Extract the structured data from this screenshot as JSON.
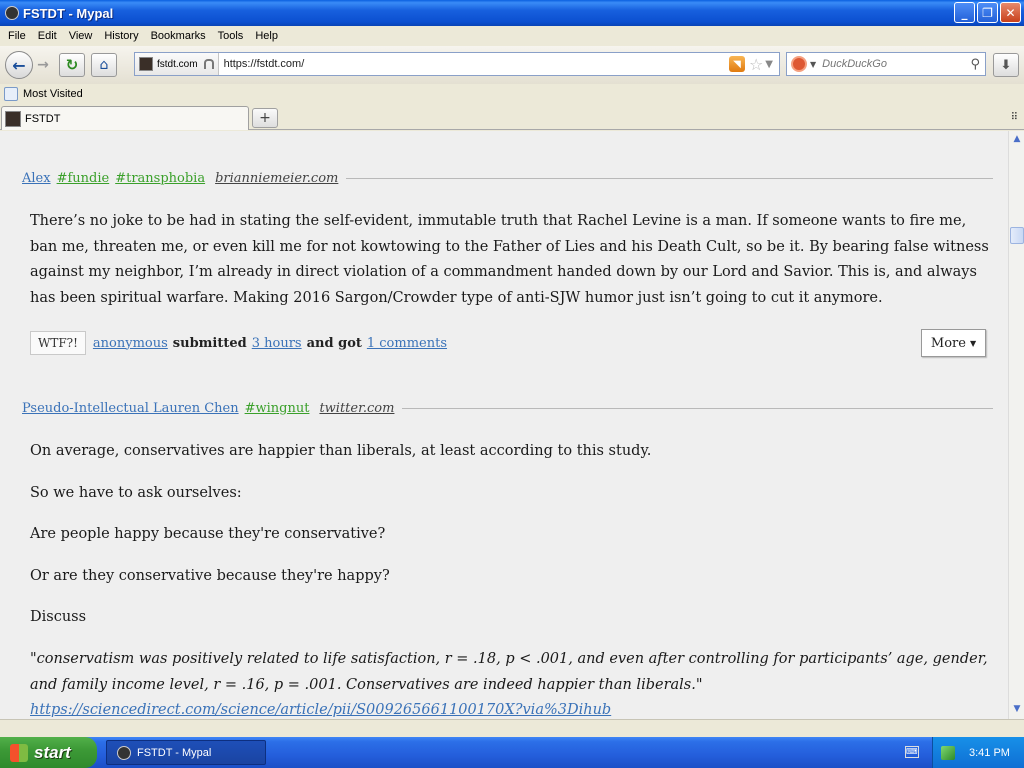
{
  "window": {
    "title": "FSTDT - Mypal",
    "minimize": "_",
    "maximize": "❐",
    "close": "✕"
  },
  "menu": [
    "File",
    "Edit",
    "View",
    "History",
    "Bookmarks",
    "Tools",
    "Help"
  ],
  "nav": {
    "identity": "fstdt.com",
    "url": "https://fstdt.com/",
    "search_placeholder": "DuckDuckGo"
  },
  "bookmarks": {
    "most_visited": "Most Visited"
  },
  "tab": {
    "title": "FSTDT"
  },
  "posts": [
    {
      "author": "Alex",
      "tags": [
        "#fundie",
        "#transphobia"
      ],
      "source": "brianniemeier.com",
      "paragraphs": [
        "There’s no joke to be had in stating the self-evident, immutable truth that Rachel Levine is a man. If someone wants to fire me, ban me, threaten me, or even kill me for not kowtowing to the Father of Lies and his Death Cult, so be it. By bearing false witness against my neighbor, I’m already in direct violation of a commandment handed down by our Lord and Savior. This is, and always has been spiritual warfare. Making 2016 Sargon/Crowder type of anti-SJW humor just isn’t going to cut it anymore."
      ],
      "actions": {
        "wtf": "WTF?!",
        "submitter": "anonymous",
        "submitted_word": "submitted",
        "time": "3 hours",
        "got_word": "and got",
        "comments": "1 comments",
        "more": "More"
      }
    },
    {
      "author": "Pseudo-Intellectual Lauren Chen",
      "tags": [
        "#wingnut"
      ],
      "source": "twitter.com",
      "paragraphs": [
        "On average, conservatives are happier than liberals, at least according to this study.",
        "So we have to ask ourselves:",
        "Are people happy because they're conservative?",
        "Or are they conservative because they're happy?",
        "Discuss"
      ],
      "quote": "\"conservatism was positively related to life satisfaction, r = .18, p < .001, and even after controlling for participants’ age, gender, and family income level, r = .16, p = .001. Conservatives are indeed happier than liberals.\"",
      "link": "https://sciencedirect.com/science/article/pii/S009265661100170X?via%3Dihub"
    }
  ],
  "taskbar": {
    "start": "start",
    "task": "FSTDT - Mypal",
    "clock": "3:41 PM"
  }
}
